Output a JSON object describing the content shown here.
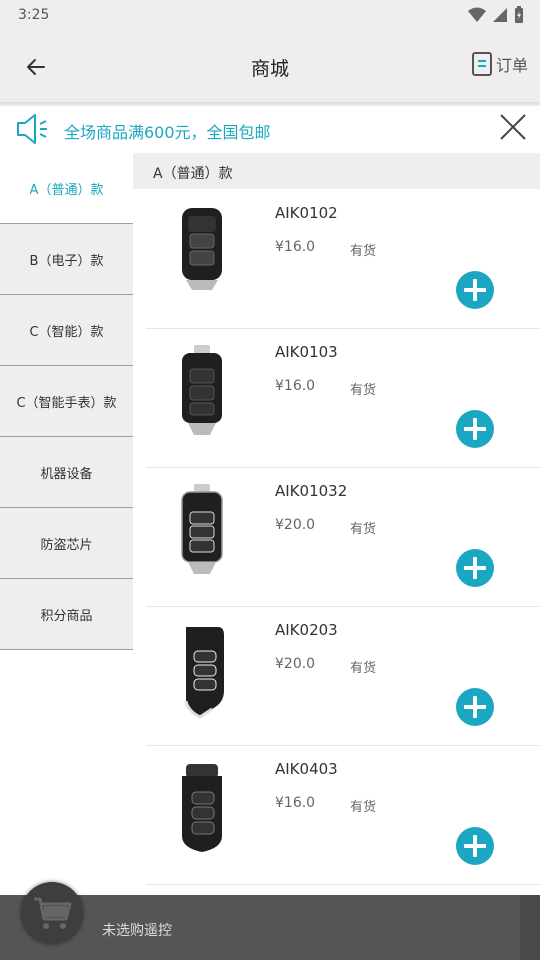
{
  "status": {
    "time": "3:25"
  },
  "header": {
    "title": "商城",
    "orders_label": "订单"
  },
  "notice": {
    "text": "全场商品满600元，全国包邮"
  },
  "sidebar": {
    "items": [
      {
        "label": "A（普通）款",
        "active": true
      },
      {
        "label": "B（电子）款"
      },
      {
        "label": "C（智能）款"
      },
      {
        "label": "C（智能手表）款"
      },
      {
        "label": "机器设备"
      },
      {
        "label": "防盗芯片"
      },
      {
        "label": "积分商品"
      }
    ]
  },
  "section": {
    "title": "A（普通）款"
  },
  "products": [
    {
      "name": "AIK0102",
      "price": "¥16.0",
      "stock": "有货"
    },
    {
      "name": "AIK0103",
      "price": "¥16.0",
      "stock": "有货"
    },
    {
      "name": "AIK01032",
      "price": "¥20.0",
      "stock": "有货"
    },
    {
      "name": "AIK0203",
      "price": "¥20.0",
      "stock": "有货"
    },
    {
      "name": "AIK0403",
      "price": "¥16.0",
      "stock": "有货"
    }
  ],
  "cart": {
    "status_text": "未选购遥控"
  },
  "colors": {
    "accent": "#1ba7c1",
    "bar_bg": "#eeeeee",
    "bottom_bg": "#555555"
  },
  "icons": {
    "back": "arrow-left-icon",
    "orders": "document-icon",
    "notice": "speaker-icon",
    "close": "close-icon",
    "add": "plus-circle-icon",
    "cart": "cart-icon"
  }
}
